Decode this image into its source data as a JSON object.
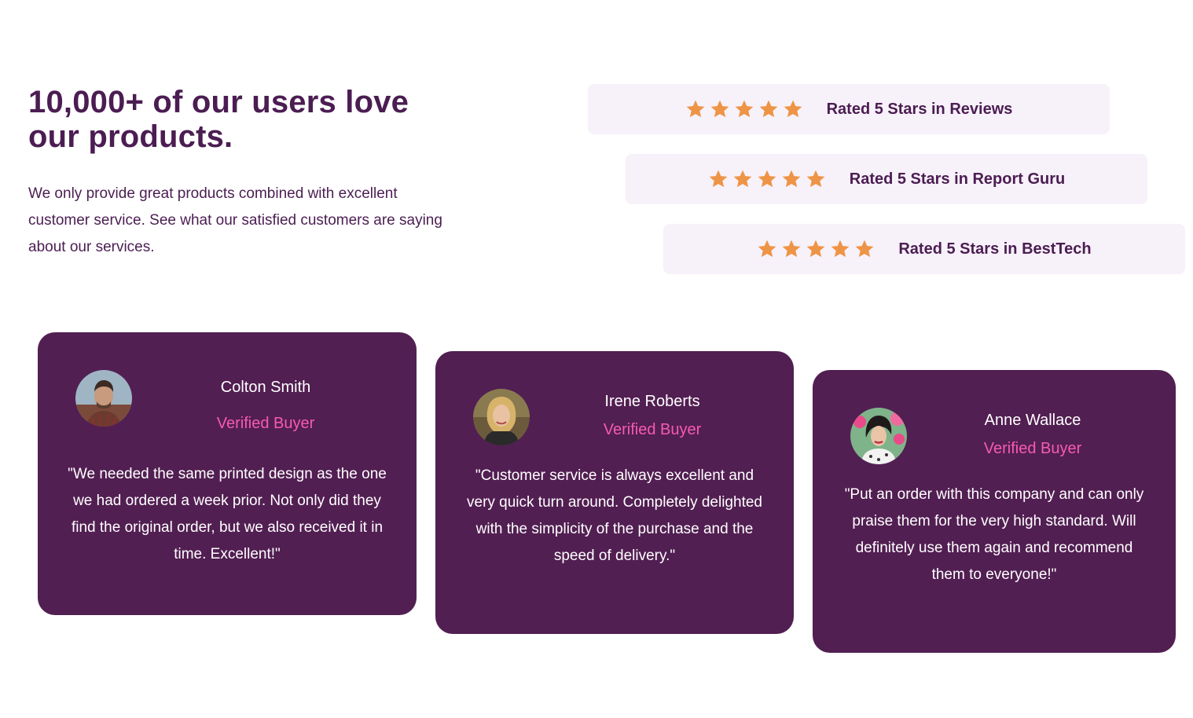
{
  "intro": {
    "title": "10,000+ of our users love our products.",
    "description": "We only provide great products combined with excellent customer service. See what our satisfied customers are saying about our services."
  },
  "ratings": [
    {
      "label": "Rated 5 Stars in Reviews",
      "stars": 5
    },
    {
      "label": "Rated 5 Stars in Report Guru",
      "stars": 5
    },
    {
      "label": "Rated 5 Stars in BestTech",
      "stars": 5
    }
  ],
  "testimonials": [
    {
      "name": "Colton Smith",
      "badge": "Verified Buyer",
      "quote": "\"We needed the same printed design as the one we had ordered a week prior. Not only did they find the original order, but we also received it in time. Excellent!\""
    },
    {
      "name": "Irene Roberts",
      "badge": "Verified Buyer",
      "quote": "\"Customer service is always excellent and very quick turn around. Completely delighted with the simplicity of the purchase and the speed of delivery.\""
    },
    {
      "name": "Anne Wallace",
      "badge": "Verified Buyer",
      "quote": "\"Put an order with this company and can only praise them for the very high standard. Will definitely use them again and recommend them to everyone!\""
    }
  ],
  "colors": {
    "primary": "#4b1d52",
    "card_bg": "#521f52",
    "rating_bg": "#f7f1f9",
    "star": "#ee9446",
    "accent_pink": "#f65bb0"
  },
  "icons": {
    "star": "star-icon",
    "avatar": "avatar-photo"
  }
}
